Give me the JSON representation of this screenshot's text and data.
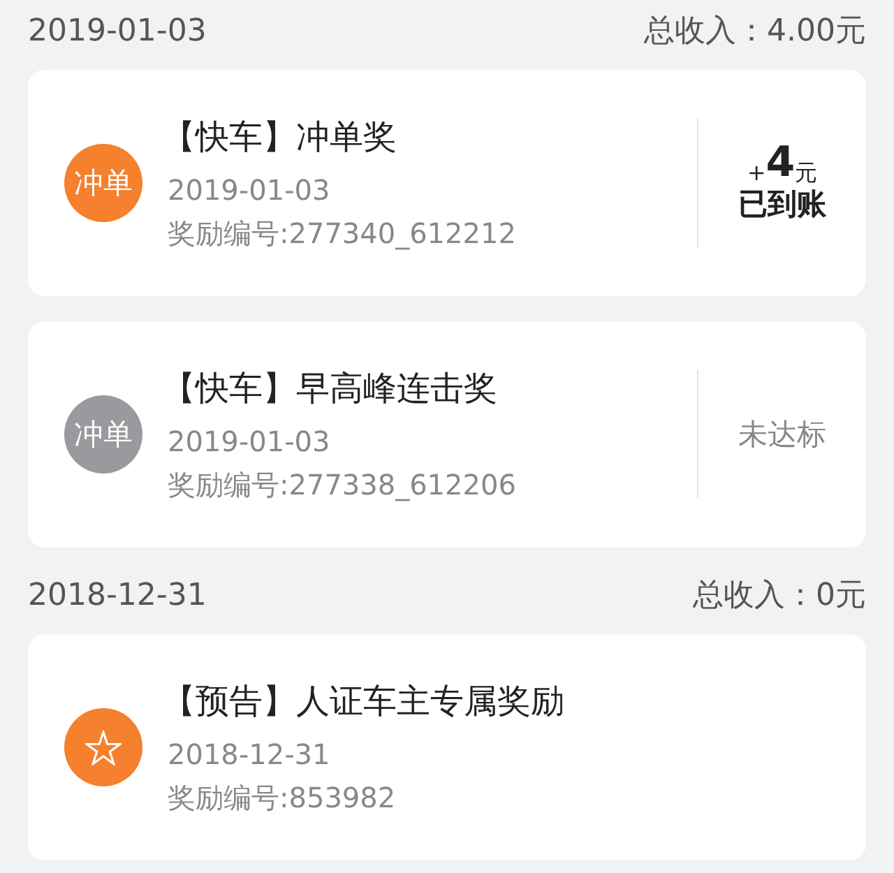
{
  "groups": [
    {
      "date": "2019-01-03",
      "total_label": "总收入：",
      "total": "4.00元",
      "items": [
        {
          "badge": {
            "kind": "text",
            "text": "冲单",
            "color": "#f5802d"
          },
          "title": "【快车】冲单奖",
          "date": "2019-01-03",
          "reward_id": "奖励编号:277340_612212",
          "result": {
            "kind": "credited",
            "sign": "+",
            "amount": "4",
            "unit": "元",
            "status": "已到账"
          }
        },
        {
          "badge": {
            "kind": "text",
            "text": "冲单",
            "color": "#9a9a9e"
          },
          "title": "【快车】早高峰连击奖",
          "date": "2019-01-03",
          "reward_id": "奖励编号:277338_612206",
          "result": {
            "kind": "pending",
            "status": "未达标"
          }
        }
      ]
    },
    {
      "date": "2018-12-31",
      "total_label": "总收入：",
      "total": "0元",
      "items": [
        {
          "badge": {
            "kind": "star",
            "color": "#f5802d"
          },
          "title": "【预告】人证车主专属奖励",
          "date": "2018-12-31",
          "reward_id": "奖励编号:853982"
        }
      ]
    }
  ]
}
